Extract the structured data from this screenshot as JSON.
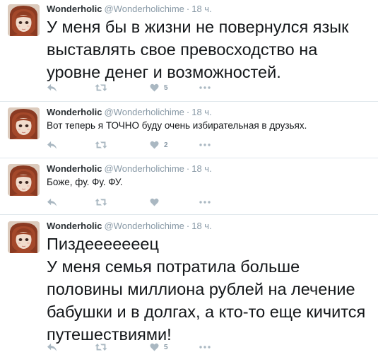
{
  "tweets": [
    {
      "name": "Wonderholic",
      "username": "@Wonderholichime",
      "time": "18 ч.",
      "text": "У меня бы в жизни не повернулся язык выставлять свое превосходство на уровне денег и возможностей.",
      "size": "big",
      "likes": "5",
      "retweets": ""
    },
    {
      "name": "Wonderholic",
      "username": "@Wonderholichime",
      "time": "18 ч.",
      "text": "Вот теперь я ТОЧНО буду очень избирательная в друзьях.",
      "size": "small",
      "likes": "2",
      "retweets": ""
    },
    {
      "name": "Wonderholic",
      "username": "@Wonderholichime",
      "time": "18 ч.",
      "text": "Боже, фу. Фу. ФУ.",
      "size": "small",
      "likes": "",
      "retweets": ""
    },
    {
      "name": "Wonderholic",
      "username": "@Wonderholichime",
      "time": "18 ч.",
      "text": "Пиздееееееец\nУ меня семья потратила больше половины миллиона рублей на лечение бабушки и в долгах, а кто-то еще кичится путешествиями!",
      "size": "big",
      "likes": "5",
      "retweets": ""
    }
  ],
  "separator": "·",
  "icons": {
    "reply": "reply-icon",
    "retweet": "retweet-icon",
    "like": "heart-icon",
    "more": "more-icon"
  },
  "colors": {
    "icon": "#aab8c2",
    "secondary_text": "#8899a6",
    "divider": "#e1e8ed"
  }
}
